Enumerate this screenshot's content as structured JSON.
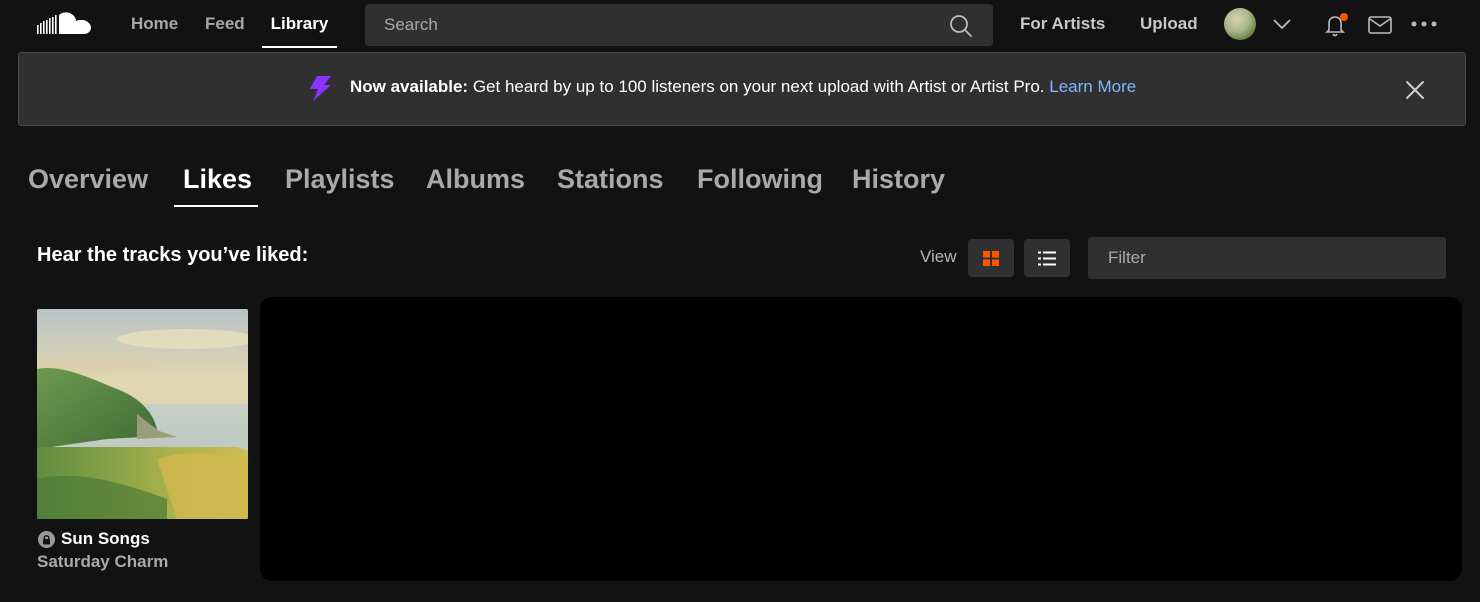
{
  "nav": {
    "links": [
      {
        "label": "Home",
        "active": false
      },
      {
        "label": "Feed",
        "active": false
      },
      {
        "label": "Library",
        "active": true
      }
    ],
    "search_placeholder": "Search",
    "for_artists": "For Artists",
    "upload": "Upload",
    "icons": [
      "soundcloud-logo",
      "search-icon",
      "chevron-down-icon",
      "bell-icon",
      "mail-icon",
      "more-icon"
    ],
    "notification_dot_color": "#ff5500"
  },
  "banner": {
    "bold": "Now available:",
    "text": " Get heard by up to 100 listeners on your next upload with Artist or Artist Pro. ",
    "link": "Learn More",
    "accent": "#8b34ff"
  },
  "tabs": [
    {
      "label": "Overview",
      "active": false
    },
    {
      "label": "Likes",
      "active": true
    },
    {
      "label": "Playlists",
      "active": false
    },
    {
      "label": "Albums",
      "active": false
    },
    {
      "label": "Stations",
      "active": false
    },
    {
      "label": "Following",
      "active": false
    },
    {
      "label": "History",
      "active": false
    }
  ],
  "section": {
    "title": "Hear the tracks you’ve liked:",
    "view_label": "View",
    "views": [
      {
        "name": "grid",
        "selected": true
      },
      {
        "name": "list",
        "selected": false
      }
    ],
    "filter_placeholder": "Filter",
    "grid_icon_color": "#ff5500"
  },
  "tracks": [
    {
      "title": "Sun Songs",
      "artist": "Saturday Charm",
      "private": true
    }
  ]
}
